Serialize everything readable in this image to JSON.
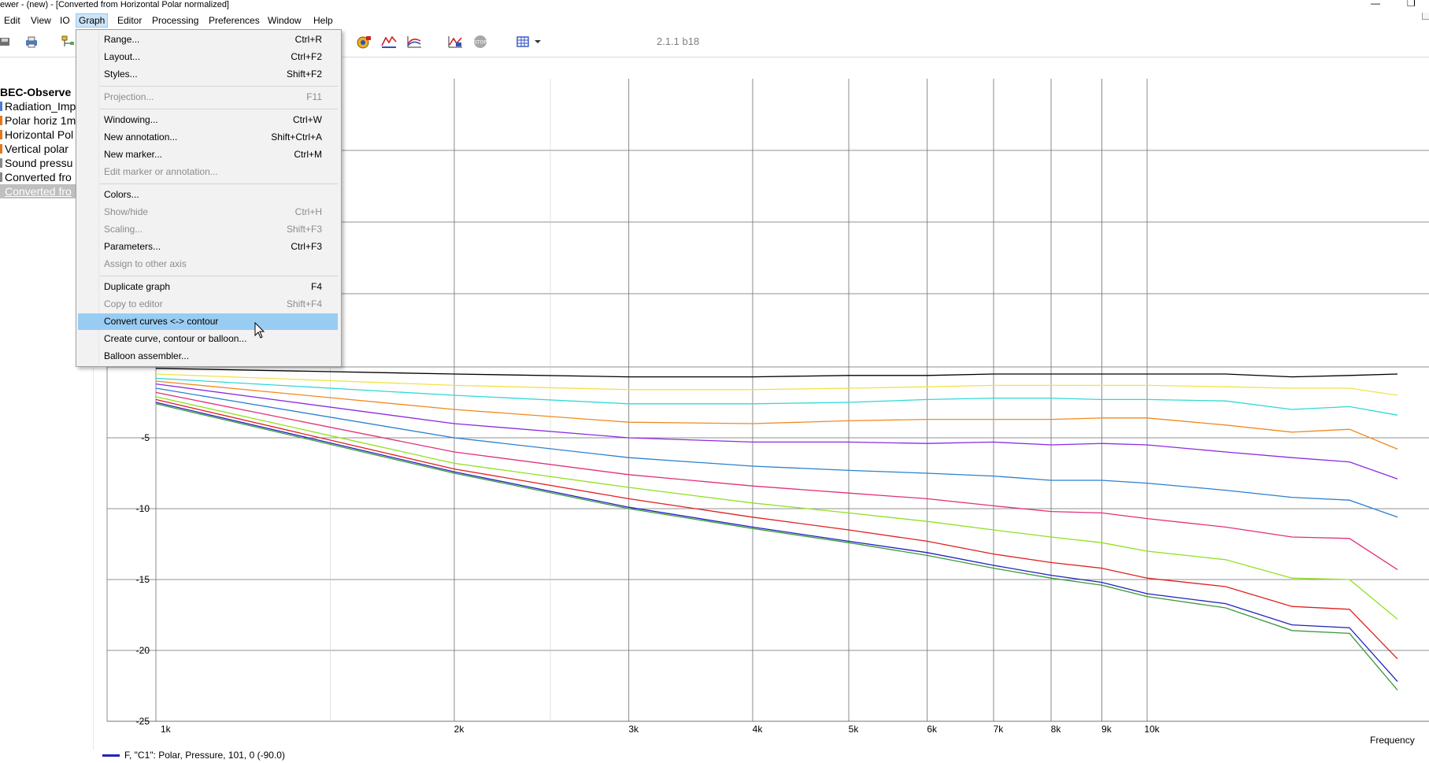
{
  "window": {
    "title": "ewer - (new) - [Converted from Horizontal Polar normalized]",
    "minimize_glyph": "—",
    "restore_glyph": "❐"
  },
  "menubar": {
    "items": [
      {
        "label": "Edit",
        "id": "edit"
      },
      {
        "label": "View",
        "id": "view"
      },
      {
        "label": "IO",
        "id": "io"
      },
      {
        "label": "Graph",
        "id": "graph"
      },
      {
        "label": "Editor",
        "id": "editor"
      },
      {
        "label": "Processing",
        "id": "processing"
      },
      {
        "label": "Preferences",
        "id": "preferences"
      },
      {
        "label": "Window",
        "id": "window"
      },
      {
        "label": "Help",
        "id": "help"
      }
    ],
    "active": "Graph"
  },
  "toolbar": {
    "version": "2.1.1 b18",
    "icons": [
      "save-icon",
      "print-icon",
      "tree-icon",
      "coil-icon",
      "xyz-chart-icon",
      "curves-chart-icon",
      "scale-chart-icon",
      "stop-icon",
      "grid-icon",
      "dropdown-arrow-icon"
    ]
  },
  "tree": {
    "root": "BEC-Observe",
    "items": [
      {
        "label": "Radiation_Imp",
        "color": "#4a7bd0"
      },
      {
        "label": "Polar horiz 1m",
        "color": "#e07820"
      },
      {
        "label": "Horizontal Pol",
        "color": "#e07820"
      },
      {
        "label": "Vertical polar",
        "color": "#e07820"
      },
      {
        "label": "Sound pressu",
        "color": "#888888"
      },
      {
        "label": "Converted fro",
        "color": "#888888"
      },
      {
        "label": "Converted fro",
        "color": "#888888",
        "selected": true
      }
    ]
  },
  "graph_menu": {
    "items": [
      {
        "label": "Range...",
        "shortcut": "Ctrl+R",
        "enabled": true
      },
      {
        "label": "Layout...",
        "shortcut": "Ctrl+F2",
        "enabled": true
      },
      {
        "label": "Styles...",
        "shortcut": "Shift+F2",
        "enabled": true
      },
      {
        "sep": true
      },
      {
        "label": "Projection...",
        "shortcut": "F11",
        "enabled": false
      },
      {
        "sep": true
      },
      {
        "label": "Windowing...",
        "shortcut": "Ctrl+W",
        "enabled": true
      },
      {
        "label": "New annotation...",
        "shortcut": "Shift+Ctrl+A",
        "enabled": true
      },
      {
        "label": "New marker...",
        "shortcut": "Ctrl+M",
        "enabled": true
      },
      {
        "label": "Edit marker or annotation...",
        "shortcut": "",
        "enabled": false
      },
      {
        "sep": true
      },
      {
        "label": "Colors...",
        "shortcut": "",
        "enabled": true
      },
      {
        "label": "Show/hide",
        "shortcut": "Ctrl+H",
        "enabled": false
      },
      {
        "label": "Scaling...",
        "shortcut": "Shift+F3",
        "enabled": false
      },
      {
        "label": "Parameters...",
        "shortcut": "Ctrl+F3",
        "enabled": true
      },
      {
        "label": "Assign to other axis",
        "shortcut": "",
        "enabled": false
      },
      {
        "sep": true
      },
      {
        "label": "Duplicate graph",
        "shortcut": "F4",
        "enabled": true
      },
      {
        "label": "Copy to editor",
        "shortcut": "Shift+F4",
        "enabled": false
      },
      {
        "label": "Convert curves <-> contour",
        "shortcut": "",
        "enabled": true,
        "highlighted": true
      },
      {
        "label": "Create curve, contour or balloon...",
        "shortcut": "",
        "enabled": true
      },
      {
        "label": "Balloon assembler...",
        "shortcut": "",
        "enabled": true
      }
    ]
  },
  "legend": {
    "text": "F, \"C1\": Polar, Pressure, 101, 0 (-90.0)",
    "color": "#2222bb"
  },
  "chart_data": {
    "type": "line",
    "xlabel": "Frequency",
    "x_scale": "log",
    "xlim": [
      1000,
      20000
    ],
    "ylim": [
      -25,
      0
    ],
    "x_tick_labels": [
      "1k",
      "2k",
      "3k",
      "4k",
      "5k",
      "6k",
      "7k",
      "8k",
      "9k",
      "10k"
    ],
    "x_ticks": [
      1000,
      2000,
      3000,
      4000,
      5000,
      6000,
      7000,
      8000,
      9000,
      10000
    ],
    "y_ticks": [
      -5,
      -10,
      -15,
      -20,
      -25
    ],
    "grid": true,
    "x": [
      1000,
      2000,
      3000,
      4000,
      5000,
      6000,
      7000,
      8000,
      9000,
      10000,
      12000,
      14000,
      16000,
      20000
    ],
    "series": [
      {
        "color": "#000000",
        "values": [
          -0.1,
          -0.5,
          -0.7,
          -0.7,
          -0.6,
          -0.6,
          -0.5,
          -0.5,
          -0.5,
          -0.5,
          -0.5,
          -0.7,
          -0.6,
          -0.5
        ]
      },
      {
        "color": "#f2e24a",
        "values": [
          -0.5,
          -1.3,
          -1.6,
          -1.6,
          -1.5,
          -1.4,
          -1.3,
          -1.3,
          -1.3,
          -1.3,
          -1.4,
          -1.5,
          -1.5,
          -2.0
        ]
      },
      {
        "color": "#30d8d8",
        "values": [
          -0.8,
          -2.0,
          -2.6,
          -2.6,
          -2.5,
          -2.3,
          -2.2,
          -2.2,
          -2.3,
          -2.3,
          -2.4,
          -3.0,
          -2.8,
          -3.4
        ]
      },
      {
        "color": "#f08a20",
        "values": [
          -1.0,
          -3.0,
          -3.9,
          -4.0,
          -3.8,
          -3.7,
          -3.7,
          -3.7,
          -3.6,
          -3.6,
          -4.1,
          -4.6,
          -4.4,
          -5.8
        ]
      },
      {
        "color": "#8a2be2",
        "values": [
          -1.2,
          -4.0,
          -5.0,
          -5.3,
          -5.3,
          -5.4,
          -5.3,
          -5.5,
          -5.4,
          -5.5,
          -6.0,
          -6.4,
          -6.7,
          -7.9
        ]
      },
      {
        "color": "#2a80d0",
        "values": [
          -1.5,
          -5.0,
          -6.4,
          -7.0,
          -7.3,
          -7.5,
          -7.7,
          -8.0,
          -8.0,
          -8.2,
          -8.7,
          -9.2,
          -9.4,
          -10.6
        ]
      },
      {
        "color": "#e0307a",
        "values": [
          -1.8,
          -6.0,
          -7.6,
          -8.4,
          -8.9,
          -9.3,
          -9.8,
          -10.2,
          -10.3,
          -10.7,
          -11.3,
          -12.0,
          -12.1,
          -14.3
        ]
      },
      {
        "color": "#90e020",
        "values": [
          -2.1,
          -6.8,
          -8.5,
          -9.6,
          -10.3,
          -10.9,
          -11.5,
          -12.0,
          -12.4,
          -13.0,
          -13.6,
          -14.9,
          -15.0,
          -17.8
        ]
      },
      {
        "color": "#e02020",
        "values": [
          -2.3,
          -7.2,
          -9.3,
          -10.6,
          -11.5,
          -12.3,
          -13.2,
          -13.8,
          -14.2,
          -14.9,
          -15.5,
          -16.9,
          -17.1,
          -20.6
        ]
      },
      {
        "color": "#2020c0",
        "values": [
          -2.5,
          -7.4,
          -9.9,
          -11.3,
          -12.3,
          -13.1,
          -14.0,
          -14.7,
          -15.2,
          -16.0,
          -16.7,
          -18.2,
          -18.4,
          -22.2
        ]
      },
      {
        "color": "#3a9a3a",
        "values": [
          -2.6,
          -7.5,
          -10.0,
          -11.4,
          -12.4,
          -13.3,
          -14.2,
          -14.9,
          -15.4,
          -16.2,
          -17.0,
          -18.6,
          -18.8,
          -22.8
        ]
      }
    ]
  }
}
